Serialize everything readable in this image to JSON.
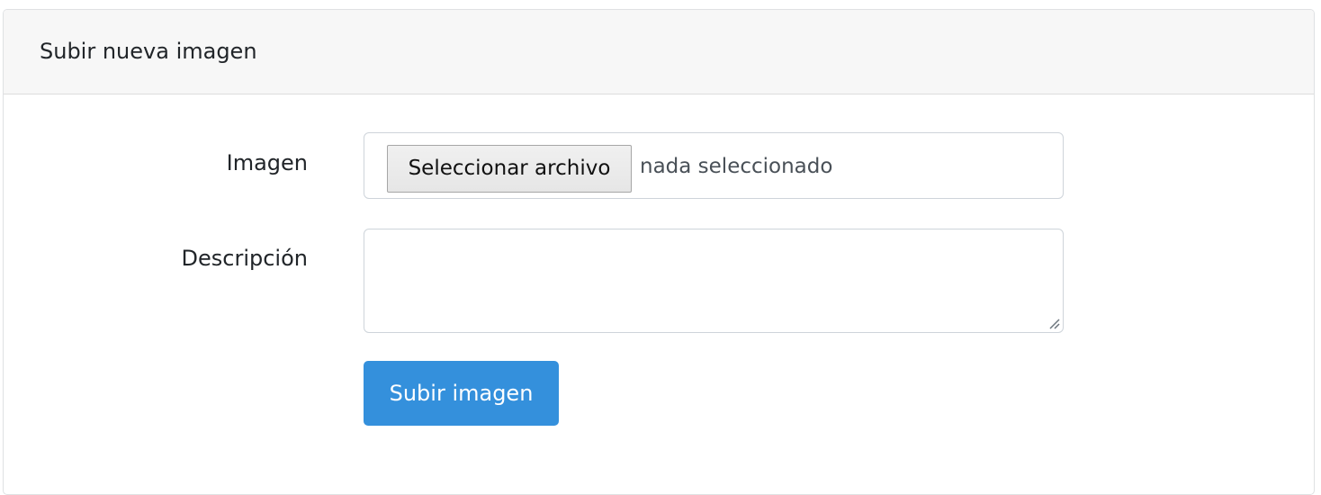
{
  "card": {
    "title": "Subir nueva imagen"
  },
  "form": {
    "image_label": "Imagen",
    "file_button_label": "Seleccionar archivo",
    "file_status": "nada seleccionado",
    "description_label": "Descripción",
    "description_value": "",
    "submit_label": "Subir imagen"
  },
  "colors": {
    "primary": "#3490dc",
    "header_background": "#f7f7f7",
    "border": "#ced4da"
  },
  "icons": {
    "textarea_resize": "resize-handle-icon"
  }
}
